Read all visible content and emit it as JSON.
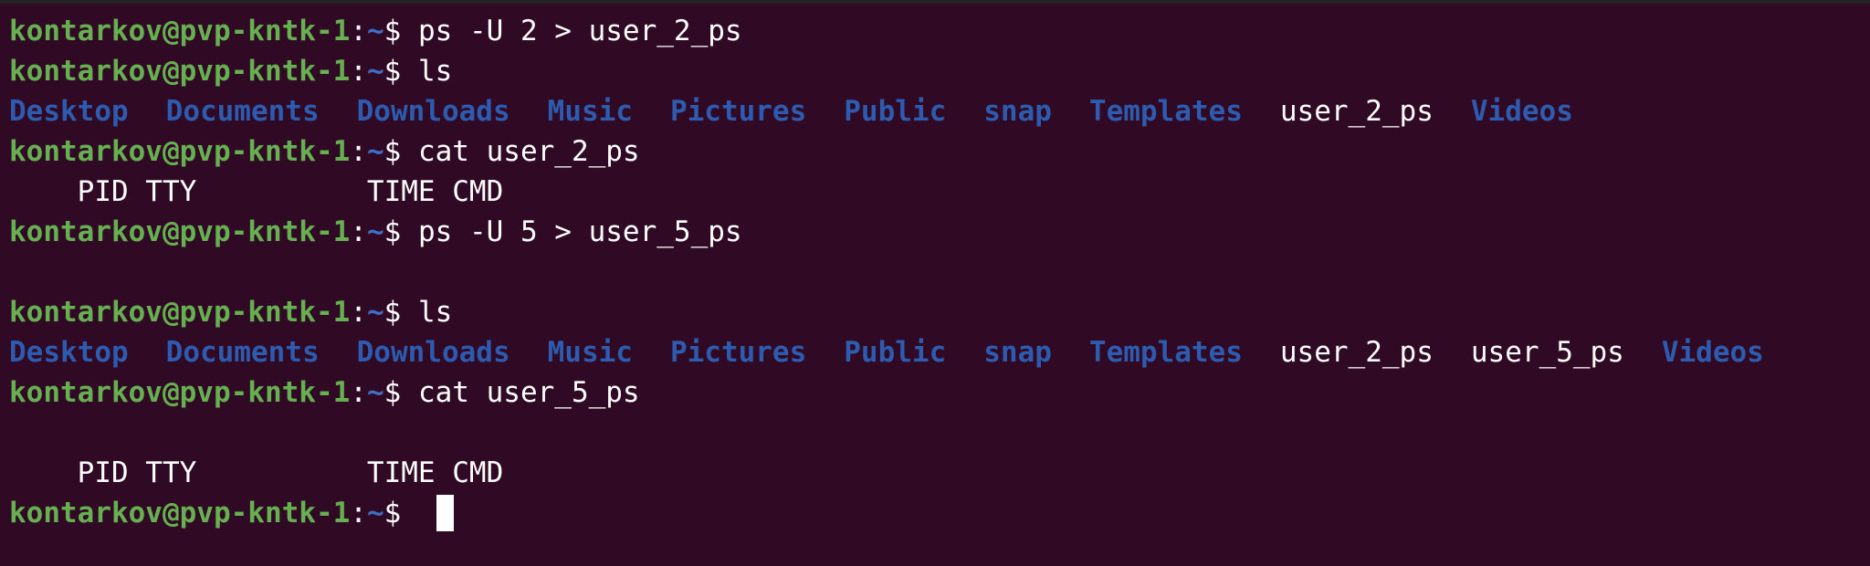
{
  "prompt": {
    "user_host": "kontarkov@pvp-kntk-1",
    "colon": ":",
    "cwd": "~",
    "dollar": "$"
  },
  "lines": [
    {
      "kind": "prompt",
      "command": "ps -U 2 > user_2_ps"
    },
    {
      "kind": "prompt",
      "command": "ls"
    },
    {
      "kind": "ls",
      "items": [
        {
          "name": "Desktop",
          "type": "dir"
        },
        {
          "name": "Documents",
          "type": "dir"
        },
        {
          "name": "Downloads",
          "type": "dir"
        },
        {
          "name": "Music",
          "type": "dir"
        },
        {
          "name": "Pictures",
          "type": "dir"
        },
        {
          "name": "Public",
          "type": "dir"
        },
        {
          "name": "snap",
          "type": "dir"
        },
        {
          "name": "Templates",
          "type": "dir"
        },
        {
          "name": "user_2_ps",
          "type": "file"
        },
        {
          "name": "Videos",
          "type": "dir"
        }
      ]
    },
    {
      "kind": "prompt",
      "command": "cat user_2_ps"
    },
    {
      "kind": "text",
      "text": "    PID TTY          TIME CMD"
    },
    {
      "kind": "prompt",
      "command": "ps -U 5 > user_5_ps"
    },
    {
      "kind": "text",
      "text": ""
    },
    {
      "kind": "prompt",
      "command": "ls"
    },
    {
      "kind": "ls",
      "items": [
        {
          "name": "Desktop",
          "type": "dir"
        },
        {
          "name": "Documents",
          "type": "dir"
        },
        {
          "name": "Downloads",
          "type": "dir"
        },
        {
          "name": "Music",
          "type": "dir"
        },
        {
          "name": "Pictures",
          "type": "dir"
        },
        {
          "name": "Public",
          "type": "dir"
        },
        {
          "name": "snap",
          "type": "dir"
        },
        {
          "name": "Templates",
          "type": "dir"
        },
        {
          "name": "user_2_ps",
          "type": "file"
        },
        {
          "name": "user_5_ps",
          "type": "file"
        },
        {
          "name": "Videos",
          "type": "dir"
        }
      ]
    },
    {
      "kind": "prompt",
      "command": "cat user_5_ps"
    },
    {
      "kind": "text",
      "text": ""
    },
    {
      "kind": "text",
      "text": "    PID TTY          TIME CMD"
    },
    {
      "kind": "prompt",
      "command": "",
      "cursor": true
    }
  ],
  "colors": {
    "background": "#300a24",
    "prompt_user_host": "#67b052",
    "prompt_cwd": "#3d6fc6",
    "directory": "#2c5bb0",
    "text": "#ffffff"
  }
}
